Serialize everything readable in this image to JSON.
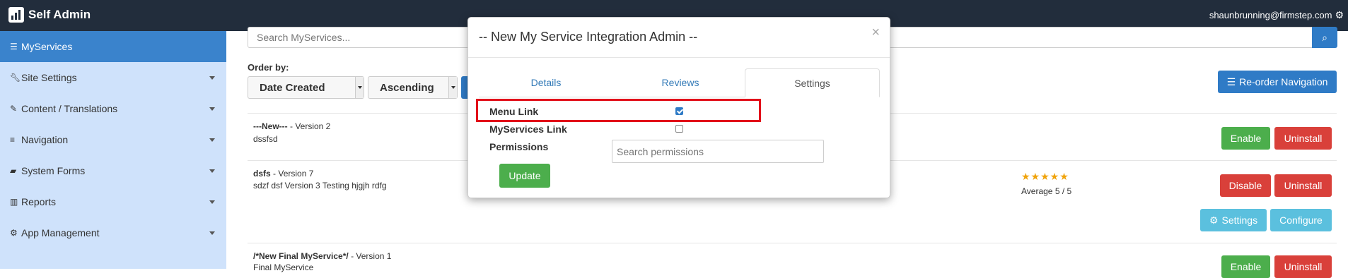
{
  "app": {
    "title": "Self Admin",
    "user": "shaunbrunning@firmstep.com"
  },
  "sidebar": {
    "items": [
      {
        "label": "MyServices",
        "icon": "list-icon",
        "active": true
      },
      {
        "label": "Site Settings",
        "icon": "wrench-icon"
      },
      {
        "label": "Content / Translations",
        "icon": "pencil-icon"
      },
      {
        "label": "Navigation",
        "icon": "bars-icon"
      },
      {
        "label": "System Forms",
        "icon": "folder-icon"
      },
      {
        "label": "Reports",
        "icon": "bar-chart-icon"
      },
      {
        "label": "App Management",
        "icon": "gear-icon"
      }
    ]
  },
  "main": {
    "search_placeholder": "Search MyServices...",
    "order_by_label": "Order by:",
    "order_field": "Date Created",
    "order_direction": "Ascending",
    "reorder_button": "Re-order Navigation",
    "services": [
      {
        "name": "---New---",
        "version": " - Version 2",
        "description": "dssfsd",
        "actions": [
          "Enable",
          "Uninstall"
        ]
      },
      {
        "name": "dsfs",
        "version": " - Version 7",
        "description": "sdzf dsf Version 3 Testing hjgjh rdfg",
        "rating_stars": 5,
        "average": "Average 5 / 5",
        "actions": [
          "Disable",
          "Uninstall",
          "Settings",
          "Configure"
        ]
      },
      {
        "name": "/*New Final MyService*/",
        "version": " - Version 1",
        "description": "Final MyService",
        "actions": [
          "Enable",
          "Uninstall"
        ]
      }
    ]
  },
  "modal": {
    "title": "-- New My Service Integration Admin --",
    "close": "×",
    "tabs": [
      "Details",
      "Reviews",
      "Settings"
    ],
    "active_tab": "Settings",
    "fields": {
      "menu_link_label": "Menu Link",
      "menu_link_checked": true,
      "myservices_link_label": "MyServices Link",
      "myservices_link_checked": false,
      "permissions_label": "Permissions",
      "permissions_placeholder": "Search permissions"
    },
    "update_button": "Update"
  },
  "colors": {
    "topbar": "#222d3c",
    "sidebar": "#cfe2fb",
    "sidebar_active": "#3a83cc",
    "primary": "#2f7bc6",
    "success": "#4cae4c",
    "danger": "#d9403a",
    "info": "#5bc0de",
    "highlight": "#e2101a"
  }
}
